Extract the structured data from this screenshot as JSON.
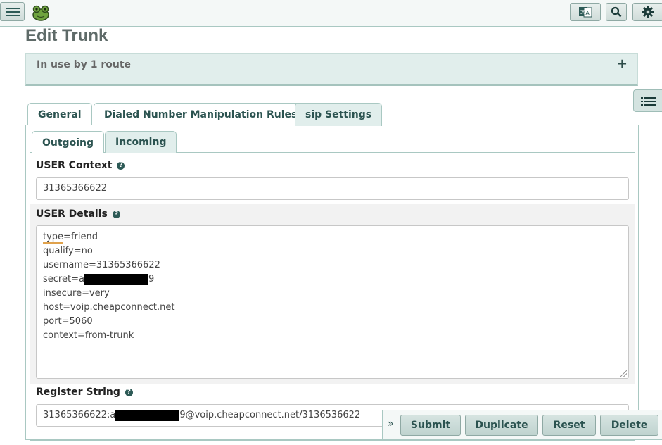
{
  "app": {
    "menu_icon": "hamburger-icon",
    "logo_icon": "frog-logo-icon",
    "toolbar_icons": [
      "translate-icon",
      "search-icon",
      "gear-icon"
    ]
  },
  "page": {
    "title": "Edit Trunk"
  },
  "usage_panel": {
    "label": "In use by 1 route",
    "expand_icon": "+"
  },
  "tabs": [
    {
      "label": "General"
    },
    {
      "label": "Dialed Number Manipulation Rules"
    },
    {
      "label": "sip Settings",
      "active": true
    }
  ],
  "subtabs": [
    {
      "label": "Outgoing"
    },
    {
      "label": "Incoming",
      "active": true
    }
  ],
  "form": {
    "user_context": {
      "label": "USER Context",
      "value": "31365366622"
    },
    "user_details": {
      "label": "USER Details",
      "lines": [
        "type=friend",
        "qualify=no",
        "username=31365366622",
        "secret=a",
        "9",
        "insecure=very",
        "host=voip.cheapconnect.net",
        "port=5060",
        "context=from-trunk"
      ],
      "type_key": "type",
      "type_value": "=friend"
    },
    "register_string": {
      "label": "Register String",
      "prefix": "31365366622:a",
      "suffix": "9@voip.cheapconnect.net/3136536622"
    }
  },
  "actions": {
    "submit": "Submit",
    "duplicate": "Duplicate",
    "reset": "Reset",
    "delete": "Delete",
    "toggle": "»"
  },
  "colors": {
    "accent": "#2b5350",
    "panel": "#e1eeec",
    "border": "#a9c8c2"
  }
}
